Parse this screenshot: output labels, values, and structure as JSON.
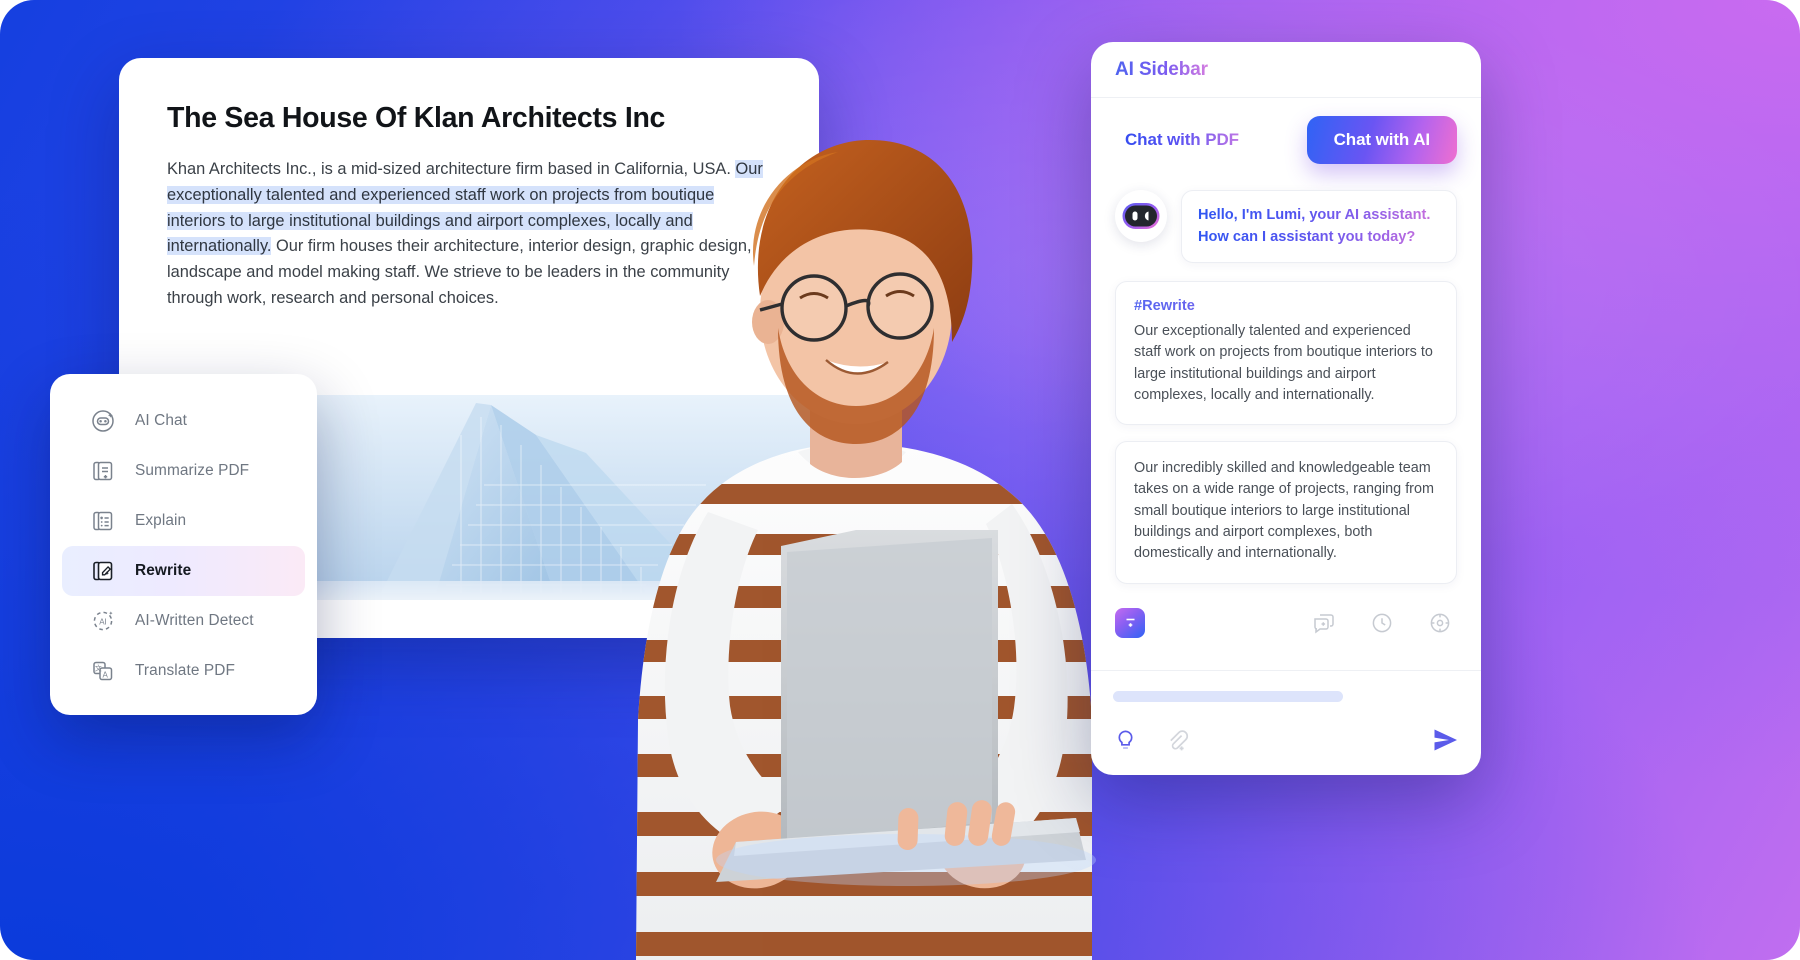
{
  "document": {
    "title": "The Sea House Of Klan Architects Inc",
    "paragraph_pre": "Khan Architects Inc., is a mid-sized architecture firm based in California, USA. ",
    "paragraph_highlight": "Our exceptionally talented and experienced staff work on projects from boutique interiors to large institutional buildings and airport complexes, locally and internationally.",
    "paragraph_post": " Our firm houses their architecture, interior design, graphic design, landscape and model making staff. We strieve to be leaders in the community through work, research and personal choices.",
    "image_alt": "architectural-building-illustration"
  },
  "menu": {
    "items": [
      {
        "label": "AI Chat",
        "icon": "robot-icon",
        "active": false
      },
      {
        "label": "Summarize PDF",
        "icon": "document-summary-icon",
        "active": false
      },
      {
        "label": "Explain",
        "icon": "document-list-icon",
        "active": false
      },
      {
        "label": "Rewrite",
        "icon": "document-pencil-icon",
        "active": true
      },
      {
        "label": "AI-Written Detect",
        "icon": "ai-detect-icon",
        "active": false
      },
      {
        "label": "Translate PDF",
        "icon": "translate-icon",
        "active": false
      }
    ]
  },
  "sidebar": {
    "title": "AI Sidebar",
    "tabs": [
      {
        "label": "Chat with PDF",
        "selected": false
      },
      {
        "label": "Chat with AI",
        "selected": true
      }
    ],
    "assistant_greeting": "Hello, I'm Lumi, your AI assistant. How can I assistant you today?",
    "avatar_icon": "lumi-bot-avatar-icon",
    "prompt_card": {
      "tag": "#Rewrite",
      "text": "Our exceptionally talented and experienced staff work on projects from boutique interiors to large institutional buildings and airport complexes, locally and internationally."
    },
    "response_card": {
      "text": "Our incredibly skilled and knowledgeable team takes on a wide range of projects, ranging from small boutique interiors to large institutional buildings and airport complexes, both domestically and internationally."
    },
    "actions": [
      {
        "icon": "rewrite-gradient-icon",
        "side": "left"
      },
      {
        "icon": "new-chat-icon",
        "side": "right"
      },
      {
        "icon": "history-clock-icon",
        "side": "right"
      },
      {
        "icon": "settings-icon",
        "side": "right"
      }
    ],
    "composer": {
      "placeholder": "",
      "lightbulb_icon": "lightbulb-icon",
      "attach_icon": "attachment-icon",
      "send_icon": "send-icon"
    }
  },
  "colors": {
    "accent_blue": "#2f63f5",
    "accent_purple": "#8a5ff2",
    "accent_pink": "#ef6fd0",
    "highlight": "#d5e2fb"
  }
}
